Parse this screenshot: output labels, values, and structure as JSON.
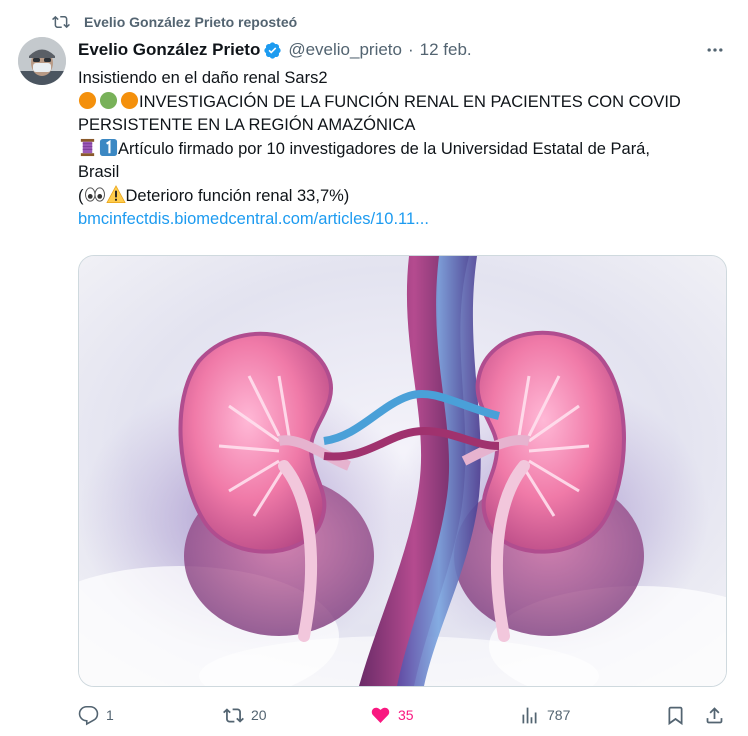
{
  "repost": {
    "label": "Evelio González Prieto reposteó"
  },
  "author": {
    "name": "Evelio González Prieto",
    "handle": "@evelio_prieto",
    "separator": "·",
    "date": "12 feb."
  },
  "tweet": {
    "line1": "Insistiendo en el daño renal Sars2",
    "line2_text": "INVESTIGACIÓN DE LA FUNCIÓN RENAL EN PACIENTES CON COVID",
    "line3": "PERSISTENTE EN LA REGIÓN AMAZÓNICA",
    "line4_text": "Artículo firmado por 10 investigadores de la Universidad Estatal de Pará,",
    "line5": "Brasil",
    "line6_open": "(",
    "line6_text": "Deterioro función renal 33,7%)",
    "link": "bmcinfectdis.biomedcentral.com/articles/10.11..."
  },
  "actions": {
    "replies": "1",
    "reposts": "20",
    "likes": "35",
    "views": "787"
  },
  "icons": [
    "repost-icon",
    "avatar",
    "verified-badge-icon",
    "more-icon",
    "orange-circle-emoji",
    "green-circle-emoji",
    "thread-emoji",
    "keycap-one-emoji",
    "eyes-emoji",
    "warning-emoji",
    "reply-icon",
    "like-icon",
    "views-icon",
    "bookmark-icon",
    "share-icon"
  ],
  "colors": {
    "accent": "#1d9bf0",
    "like": "#f91880",
    "muted": "#536471",
    "text": "#0f1419"
  }
}
